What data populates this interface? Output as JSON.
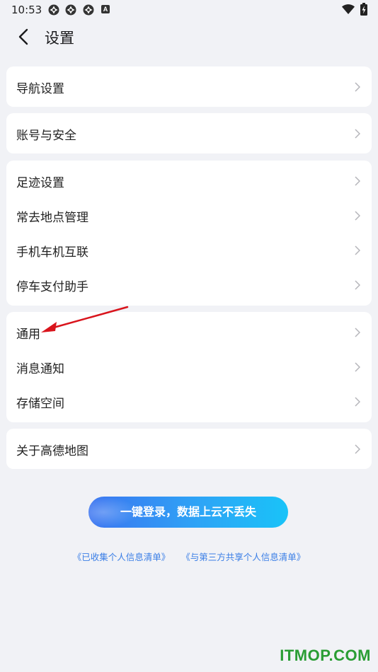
{
  "status_bar": {
    "time": "10:53",
    "app_icons": [
      "app-notification-icon",
      "app-notification-icon",
      "app-notification-icon"
    ],
    "a_badge": "A",
    "icons": [
      "wifi-icon",
      "battery-charging-icon"
    ]
  },
  "header": {
    "back_icon": "chevron-left-icon",
    "title": "设置"
  },
  "groups": [
    {
      "items": [
        {
          "label": "导航设置"
        }
      ]
    },
    {
      "items": [
        {
          "label": "账号与安全"
        }
      ]
    },
    {
      "items": [
        {
          "label": "足迹设置"
        },
        {
          "label": "常去地点管理"
        },
        {
          "label": "手机车机互联"
        },
        {
          "label": "停车支付助手"
        }
      ]
    },
    {
      "items": [
        {
          "label": "通用"
        },
        {
          "label": "消息通知"
        },
        {
          "label": "存储空间"
        }
      ]
    },
    {
      "items": [
        {
          "label": "关于高德地图"
        }
      ]
    }
  ],
  "login_button": {
    "label": "一键登录，数据上云不丢失"
  },
  "policy_links": {
    "collected": "《已收集个人信息清单》",
    "shared": "《与第三方共享个人信息清单》"
  },
  "watermark": "ITMOP.COM",
  "colors": {
    "background": "#f1f2f6",
    "card": "#ffffff",
    "link": "#3a7ee6",
    "button_gradient_start": "#3b74f0",
    "button_gradient_end": "#19c3f8",
    "annotation_arrow": "#d9141c",
    "watermark": "#2a9d34"
  }
}
